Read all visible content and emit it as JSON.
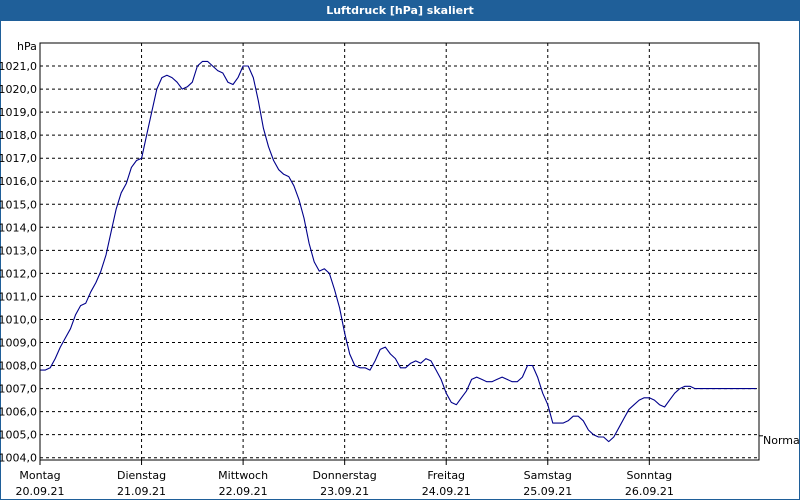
{
  "window": {
    "title": "Luftdruck [hPa] skaliert"
  },
  "colors": {
    "title_bar": "#1f5f99",
    "line": "#00008b",
    "grid": "#000000",
    "background": "#ffffff"
  },
  "chart_data": {
    "type": "line",
    "title": "Luftdruck [hPa] skaliert",
    "ylabel": "hPa",
    "xlabel": "",
    "ylim": [
      1003.9,
      1022.0
    ],
    "xlim": [
      0,
      7.08
    ],
    "y_ticks": [
      1004.0,
      1005.0,
      1006.0,
      1007.0,
      1008.0,
      1009.0,
      1010.0,
      1011.0,
      1012.0,
      1013.0,
      1014.0,
      1015.0,
      1016.0,
      1017.0,
      1018.0,
      1019.0,
      1020.0,
      1021.0
    ],
    "y_tick_labels": [
      "1004,0",
      "1005,0",
      "1006,0",
      "1007,0",
      "1008,0",
      "1009,0",
      "1010,0",
      "1011,0",
      "1012,0",
      "1013,0",
      "1014,0",
      "1015,0",
      "1016,0",
      "1017,0",
      "1018,0",
      "1019,0",
      "1020,0",
      "1021,0"
    ],
    "x_ticks": [
      0,
      1,
      2,
      3,
      4,
      5,
      6
    ],
    "x_tick_labels": [
      {
        "day": "Montag",
        "date": "20.09.21"
      },
      {
        "day": "Dienstag",
        "date": "21.09.21"
      },
      {
        "day": "Mittwoch",
        "date": "22.09.21"
      },
      {
        "day": "Donnerstag",
        "date": "23.09.21"
      },
      {
        "day": "Freitag",
        "date": "24.09.21"
      },
      {
        "day": "Samstag",
        "date": "25.09.21"
      },
      {
        "day": "Sonntag",
        "date": "26.09.21"
      }
    ],
    "reference_label": "Normal",
    "reference_value": 1004.95,
    "grid": true,
    "series": [
      {
        "x": [
          0.0,
          0.05,
          0.1,
          0.15,
          0.2,
          0.25,
          0.3,
          0.35,
          0.4,
          0.45,
          0.5,
          0.55,
          0.6,
          0.65,
          0.7,
          0.75,
          0.8,
          0.85,
          0.9,
          0.95,
          1.0,
          1.05,
          1.1,
          1.15,
          1.2,
          1.25,
          1.3,
          1.35,
          1.4,
          1.45,
          1.5,
          1.55,
          1.6,
          1.65,
          1.7,
          1.75,
          1.8,
          1.85,
          1.9,
          1.95,
          2.0,
          2.05,
          2.1,
          2.15,
          2.2,
          2.25,
          2.3,
          2.35,
          2.4,
          2.45,
          2.5,
          2.55,
          2.6,
          2.65,
          2.7,
          2.75,
          2.8,
          2.85,
          2.9,
          2.95,
          3.0,
          3.05,
          3.1,
          3.15,
          3.2,
          3.25,
          3.3,
          3.35,
          3.4,
          3.45,
          3.5,
          3.55,
          3.6,
          3.65,
          3.7,
          3.75,
          3.8,
          3.85,
          3.9,
          3.95,
          4.0,
          4.05,
          4.1,
          4.15,
          4.2,
          4.25,
          4.3,
          4.35,
          4.4,
          4.45,
          4.5,
          4.55,
          4.6,
          4.65,
          4.7,
          4.75,
          4.8,
          4.85,
          4.9,
          4.95,
          5.0,
          5.05,
          5.1,
          5.15,
          5.2,
          5.25,
          5.3,
          5.35,
          5.4,
          5.45,
          5.5,
          5.55,
          5.6,
          5.65,
          5.7,
          5.75,
          5.8,
          5.85,
          5.9,
          5.95,
          6.0,
          6.05,
          6.1,
          6.15,
          6.2,
          6.25,
          6.3,
          6.35,
          6.4,
          6.45,
          6.5,
          6.55,
          6.6,
          6.65,
          6.7,
          6.75,
          6.8,
          6.85,
          6.9,
          6.95,
          7.0,
          7.05
        ],
        "values": [
          1007.8,
          1007.8,
          1007.9,
          1008.3,
          1008.8,
          1009.2,
          1009.6,
          1010.2,
          1010.6,
          1010.7,
          1011.2,
          1011.6,
          1012.1,
          1012.8,
          1013.8,
          1014.8,
          1015.5,
          1015.9,
          1016.6,
          1016.9,
          1017.0,
          1018.0,
          1019.0,
          1020.0,
          1020.5,
          1020.6,
          1020.5,
          1020.3,
          1020.0,
          1020.1,
          1020.3,
          1021.0,
          1021.2,
          1021.2,
          1021.0,
          1020.8,
          1020.7,
          1020.3,
          1020.2,
          1020.5,
          1021.0,
          1021.0,
          1020.5,
          1019.5,
          1018.3,
          1017.5,
          1016.9,
          1016.5,
          1016.3,
          1016.2,
          1015.8,
          1015.2,
          1014.4,
          1013.3,
          1012.5,
          1012.1,
          1012.2,
          1012.0,
          1011.3,
          1010.5,
          1009.4,
          1008.5,
          1008.0,
          1007.9,
          1007.9,
          1007.8,
          1008.2,
          1008.7,
          1008.8,
          1008.5,
          1008.3,
          1007.9,
          1007.9,
          1008.1,
          1008.2,
          1008.1,
          1008.3,
          1008.2,
          1007.8,
          1007.4,
          1006.8,
          1006.4,
          1006.3,
          1006.6,
          1006.9,
          1007.4,
          1007.5,
          1007.4,
          1007.3,
          1007.3,
          1007.4,
          1007.5,
          1007.4,
          1007.3,
          1007.3,
          1007.5,
          1008.0,
          1008.0,
          1007.5,
          1006.8,
          1006.3,
          1005.5,
          1005.5,
          1005.5,
          1005.6,
          1005.8,
          1005.8,
          1005.6,
          1005.2,
          1005.0,
          1004.9,
          1004.9,
          1004.7,
          1004.9,
          1005.3,
          1005.7,
          1006.1,
          1006.3,
          1006.5,
          1006.6,
          1006.6,
          1006.5,
          1006.3,
          1006.2,
          1006.5,
          1006.8,
          1007.0,
          1007.1,
          1007.1,
          1007.0,
          1007.0,
          1007.0,
          1007.0,
          1007.0,
          1007.0,
          1007.0,
          1007.0,
          1007.0,
          1007.0,
          1007.0,
          1007.0,
          1007.0
        ]
      }
    ]
  }
}
